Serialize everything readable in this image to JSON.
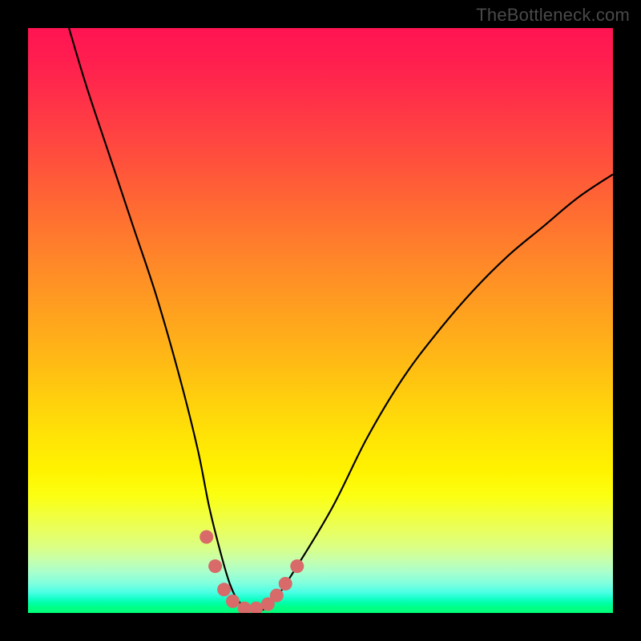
{
  "watermark": "TheBottleneck.com",
  "chart_data": {
    "type": "line",
    "title": "",
    "xlabel": "",
    "ylabel": "",
    "xlim": [
      0,
      100
    ],
    "ylim": [
      0,
      100
    ],
    "series": [
      {
        "name": "bottleneck-curve",
        "x": [
          7,
          10,
          14,
          18,
          22,
          26,
          29,
          31,
          33,
          34.5,
          36,
          38,
          40,
          42,
          46,
          52,
          58,
          64,
          70,
          76,
          82,
          88,
          94,
          100
        ],
        "y": [
          100,
          90,
          78,
          66,
          54,
          40,
          28,
          18,
          10,
          5,
          2,
          0.5,
          0.5,
          2,
          8,
          18,
          30,
          40,
          48,
          55,
          61,
          66,
          71,
          75
        ]
      }
    ],
    "markers": {
      "name": "highlight-points",
      "x": [
        30.5,
        32,
        33.5,
        35,
        37,
        39,
        41,
        42.5,
        44,
        46
      ],
      "y": [
        13,
        8,
        4,
        2,
        0.8,
        0.8,
        1.5,
        3,
        5,
        8
      ],
      "color": "#d86a6a"
    },
    "gradient_stops": [
      {
        "pos": 0,
        "color": "#ff1452"
      },
      {
        "pos": 50,
        "color": "#ffa81c"
      },
      {
        "pos": 76,
        "color": "#fff400"
      },
      {
        "pos": 100,
        "color": "#00ff78"
      }
    ]
  }
}
